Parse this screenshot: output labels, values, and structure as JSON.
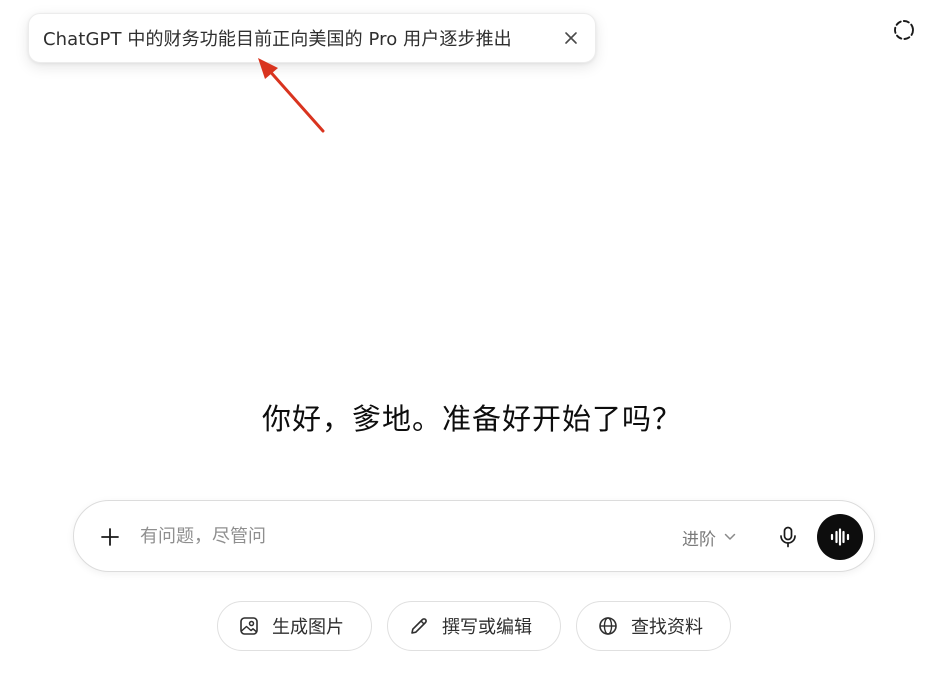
{
  "toast": {
    "message": "ChatGPT 中的财务功能目前正向美国的 Pro 用户逐步推出",
    "close_icon": "close-icon"
  },
  "annotation": {
    "arrow_color": "#d9341f"
  },
  "header": {
    "temporary_chat_icon": "dashed-circle-icon"
  },
  "greeting": {
    "text": "你好，爹地。准备好开始了吗？"
  },
  "composer": {
    "placeholder": "有问题，尽管问",
    "value": "",
    "model_label": "进阶",
    "plus_icon": "plus-icon",
    "mic_icon": "microphone-icon",
    "voice_icon": "voice-waveform-icon",
    "voice_button_color": "#0d0d0d"
  },
  "actions": [
    {
      "label": "生成图片",
      "icon": "image-icon"
    },
    {
      "label": "撰写或编辑",
      "icon": "pencil-icon"
    },
    {
      "label": "查找资料",
      "icon": "globe-icon"
    }
  ]
}
